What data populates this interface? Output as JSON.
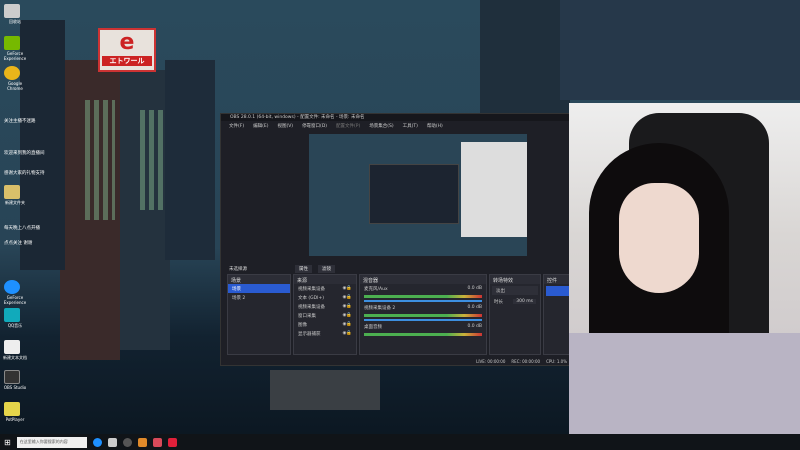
{
  "desktop": {
    "icons": [
      "回收站",
      "GeForce Experience",
      "Google Chrome",
      "新建文件夹",
      "GeForce Experience",
      "QQ音乐",
      "新建文本文档",
      "OBS Studio",
      "PotPlayer"
    ],
    "overlay_lines": [
      "关注主播不迷路",
      "欢迎来到我的直播间",
      "感谢大家的礼物支持",
      "每天晚上八点开播",
      "点点关注 谢谢"
    ],
    "sign_text": "エトワール"
  },
  "obs": {
    "title": "OBS 28.0.1 (64-bit, windows) - 配置文件: 未命名 - 场景: 未命名",
    "menu": [
      "文件(F)",
      "编辑(E)",
      "视图(V)",
      "停靠窗口(D)",
      "配置文件(P)",
      "场景集合(S)",
      "工具(T)",
      "帮助(H)"
    ],
    "dock_row": {
      "label": "未选择源",
      "properties": "属性",
      "filters": "滤镜"
    },
    "scenes": {
      "title": "场景",
      "items": [
        "场景",
        "场景 2"
      ]
    },
    "sources": {
      "title": "来源",
      "items": [
        "视频采集设备",
        "文本 (GDI+)",
        "视频采集设备",
        "窗口采集",
        "图像",
        "显示器捕获"
      ]
    },
    "mixer": {
      "title": "混音器",
      "channels": [
        {
          "name": "麦克风/Aux",
          "db": "0.0 dB"
        },
        {
          "name": "视频采集设备 2",
          "db": "0.0 dB"
        },
        {
          "name": "桌面音频",
          "db": "0.0 dB"
        }
      ]
    },
    "transitions": {
      "title": "转场特效",
      "type": "淡出",
      "duration_label": "时长",
      "duration": "300 ms"
    },
    "controls": {
      "title": "控件"
    },
    "status": {
      "live": "LIVE: 00:00:00",
      "rec": "REC: 00:00:00",
      "cpu": "CPU: 1.0%"
    }
  },
  "taskbar": {
    "search_placeholder": "在这里输入你要搜索的内容"
  }
}
